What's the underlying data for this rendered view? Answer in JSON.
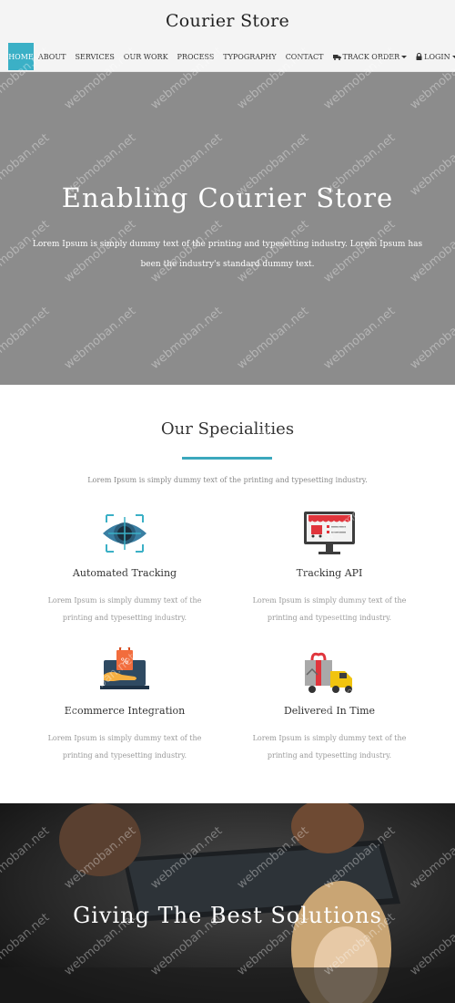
{
  "header": {
    "brand": "Courier Store",
    "nav": [
      {
        "label": "HOME",
        "active": true
      },
      {
        "label": "ABOUT"
      },
      {
        "label": "SERVICES"
      },
      {
        "label": "OUR WORK"
      },
      {
        "label": "PROCESS"
      },
      {
        "label": "TYPOGRAPHY"
      },
      {
        "label": "CONTACT"
      },
      {
        "label": "TRACK ORDER",
        "icon": "truck-icon",
        "dropdown": true
      },
      {
        "label": "LOGIN",
        "icon": "lock-icon",
        "dropdown": true
      }
    ]
  },
  "hero": {
    "title": "Enabling Courier Store",
    "text": "Lorem Ipsum is simply dummy text of the printing and typesetting industry. Lorem Ipsum has been the industry's standard dummy text."
  },
  "specialities": {
    "title": "Our Specialities",
    "subtitle": "Lorem Ipsum is simply dummy text of the printing and typesetting industry.",
    "items": [
      {
        "name": "Automated Tracking",
        "icon": "target-eye-icon",
        "description": "Lorem Ipsum is simply dummy text of the printing and typesetting industry."
      },
      {
        "name": "Tracking API",
        "icon": "monitor-store-icon",
        "description": "Lorem Ipsum is simply dummy text of the printing and typesetting industry."
      },
      {
        "name": "Ecommerce Integration",
        "icon": "shopping-laptop-icon",
        "description": "Lorem Ipsum is simply dummy text of the printing and typesetting industry."
      },
      {
        "name": "Delivered In Time",
        "icon": "delivery-truck-icon",
        "description": "Lorem Ipsum is simply dummy text of the printing and typesetting industry."
      }
    ]
  },
  "band": {
    "title": "Giving The Best Solutions"
  },
  "watermark": "webmoban.net",
  "colors": {
    "accent": "#3bb0c6",
    "hero_bg": "#8c8c8c",
    "band_bg": "#2b2b2b"
  }
}
